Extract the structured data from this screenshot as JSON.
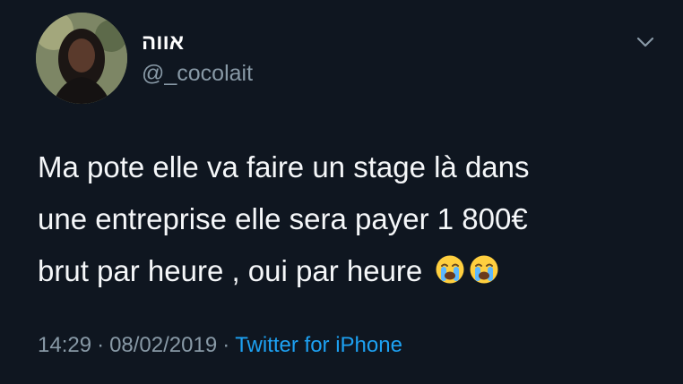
{
  "user": {
    "display_name": "אווה",
    "handle": "@_cocolait"
  },
  "tweet": {
    "text": "Ma pote elle va faire un stage là dans\nune entreprise elle sera payer 1 800€\nbrut par heure , oui par heure",
    "emojis": [
      "crying-face-emoji",
      "crying-face-emoji"
    ],
    "time": "14:29",
    "date": "08/02/2019",
    "separator": "·",
    "source": "Twitter for iPhone"
  },
  "colors": {
    "background": "#0f1620",
    "text": "#f5f7f9",
    "muted": "#8899a6",
    "link": "#1da1f2"
  },
  "icons": {
    "menu": "chevron-down-icon"
  }
}
